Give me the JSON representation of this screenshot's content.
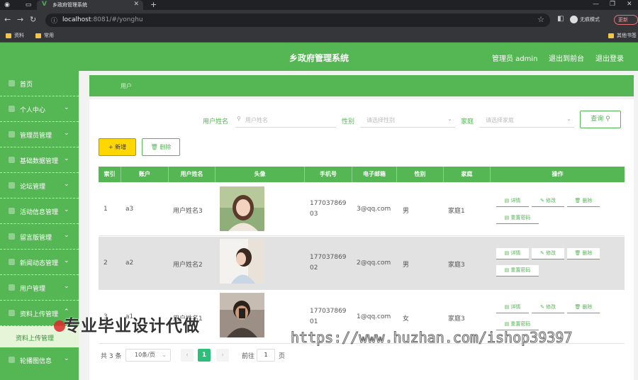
{
  "browser": {
    "tab_title": "乡政府管理系统",
    "url_host": "localhost",
    "url_rest": ":8081/#/yonghu",
    "incognito_label": "无痕模式",
    "update_label": "更新",
    "bookmarks": [
      "资料",
      "常用"
    ],
    "bookmarks_right": "其他书签"
  },
  "header": {
    "title": "乡政府管理系统",
    "user_label": "管理员 admin",
    "back_label": "退出到前台",
    "logout_label": "退出登录"
  },
  "sidebar": {
    "items": [
      {
        "label": "首页",
        "chevron": false
      },
      {
        "label": "个人中心",
        "chevron": true
      },
      {
        "label": "管理员管理",
        "chevron": true
      },
      {
        "label": "基础数据管理",
        "chevron": true
      },
      {
        "label": "论坛管理",
        "chevron": true
      },
      {
        "label": "活动信息管理",
        "chevron": true
      },
      {
        "label": "留言版管理",
        "chevron": true
      },
      {
        "label": "新闻动态管理",
        "chevron": true
      },
      {
        "label": "用户管理",
        "chevron": true
      },
      {
        "label": "资料上传管理",
        "chevron": true
      }
    ],
    "submenu_label": "资料上传管理",
    "last_item": "轮播图信息"
  },
  "breadcrumb": "用户",
  "filters": {
    "name_label": "用户姓名",
    "name_placeholder": "用户姓名",
    "gender_label": "性别",
    "gender_placeholder": "请选择性别",
    "family_label": "家庭",
    "family_placeholder": "请选择家庭",
    "query_label": "查询"
  },
  "actions": {
    "add_label": "新增",
    "delete_label": "删除"
  },
  "table": {
    "headers": [
      "索引",
      "账户",
      "用户姓名",
      "头像",
      "手机号",
      "电子邮箱",
      "性别",
      "家庭",
      "操作"
    ],
    "rows": [
      {
        "index": "1",
        "account": "a3",
        "name": "用户姓名3",
        "phone1": "177037869",
        "phone2": "03",
        "email": "3@qq.com",
        "gender": "男",
        "family": "家庭1"
      },
      {
        "index": "2",
        "account": "a2",
        "name": "用户姓名2",
        "phone1": "177037869",
        "phone2": "02",
        "email": "2@qq.com",
        "gender": "男",
        "family": "家庭3"
      },
      {
        "index": "3",
        "account": "a1",
        "name": "用户姓名1",
        "phone1": "177037869",
        "phone2": "01",
        "email": "1@qq.com",
        "gender": "女",
        "family": "家庭3"
      }
    ],
    "ops": {
      "detail": "详情",
      "edit": "修改",
      "delete": "删除",
      "reset": "重置密码"
    }
  },
  "pagination": {
    "total": "共 3 条",
    "page_size": "10条/页",
    "current": "1",
    "goto_label": "前往",
    "goto_value": "1",
    "page_unit": "页"
  },
  "watermark": {
    "cn": "专业毕业设计代做",
    "url": "https://www.huzhan.com/ishop39397"
  },
  "colors": {
    "brand": "#55b654",
    "add_button": "#ffd700",
    "page_current": "#2bbf7a"
  }
}
